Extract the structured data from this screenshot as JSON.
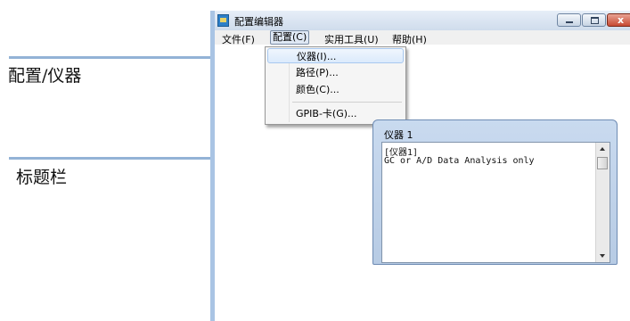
{
  "annotations": {
    "config_instrument": "配置/仪器",
    "title_bar": "标题栏"
  },
  "window": {
    "title": "配置编辑器",
    "close_symbol": "x"
  },
  "menubar": {
    "file": "文件(F)",
    "config": "配置(C)",
    "tools": "实用工具(U)",
    "help": "帮助(H)"
  },
  "config_menu": {
    "items": [
      "仪器(I)...",
      "路径(P)...",
      "颜色(C)...",
      "GPIB-卡(G)..."
    ],
    "highlighted": "仪器(I)..."
  },
  "child_window": {
    "title": "仪器 1",
    "lines": [
      "[仪器1]",
      "GC or A/D Data Analysis only"
    ]
  },
  "colors": {
    "callout_line": "#93b3d6",
    "window_border": "#a9c4e4",
    "close_button": "#c74a33"
  }
}
